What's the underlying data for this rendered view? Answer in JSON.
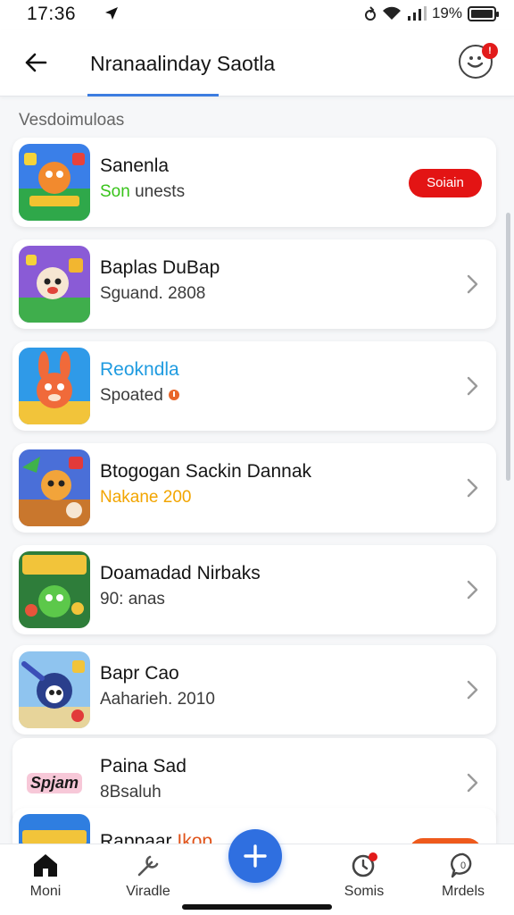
{
  "status_bar": {
    "time": "17:36",
    "battery": "19%"
  },
  "header": {
    "title": "Nranaalinday Saotla"
  },
  "section": {
    "label": "Vesdoimuloas"
  },
  "items": [
    {
      "name": "Sanenla",
      "sub_a": "Son",
      "sub_b": " unests",
      "sub_a_color": "#38c31a",
      "action": "Soiain"
    },
    {
      "name": "Baplas DuBap",
      "sub": "Sguand. 2808"
    },
    {
      "name": "Reokndla",
      "name_color": "#1f9be0",
      "sub": "Spoated"
    },
    {
      "name": "Btogogan Sackin Dannak",
      "sub": "Nakane 200",
      "sub_color": "#f2a500"
    },
    {
      "name": "Doamadad Nirbaks",
      "sub": "90: anas"
    },
    {
      "name": "Bapr Cao",
      "sub": "Aaharieh. 2010"
    },
    {
      "name": "Paina Sad",
      "sub": "8Bsaluh",
      "thumb_text": "Spjam"
    },
    {
      "name": "Rappaar",
      "name_accent": "Ikop"
    }
  ],
  "nav": {
    "home": "Moni",
    "tools": "Viradle",
    "notices": "Somis",
    "messages": "Mrdels"
  },
  "colors": {
    "accent": "#2f6fe0",
    "danger": "#e31414",
    "text": "#151515"
  }
}
